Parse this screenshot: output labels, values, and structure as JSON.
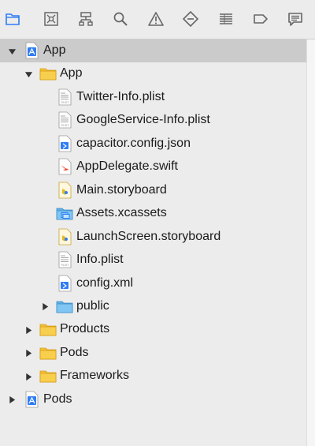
{
  "toolbar": {
    "items": [
      {
        "name": "project-navigator-icon",
        "active": true
      },
      {
        "name": "source-control-icon"
      },
      {
        "name": "symbol-navigator-icon"
      },
      {
        "name": "find-navigator-icon"
      },
      {
        "name": "issue-navigator-icon"
      },
      {
        "name": "test-navigator-icon"
      },
      {
        "name": "debug-navigator-icon"
      },
      {
        "name": "breakpoint-navigator-icon"
      },
      {
        "name": "report-navigator-icon"
      }
    ],
    "accent": "#2f7cf6"
  },
  "tree": {
    "rows": [
      {
        "label": "App",
        "icon": "xcode-project-icon",
        "level": 0,
        "disclosure": "expanded",
        "selected": true
      },
      {
        "label": "App",
        "icon": "folder-icon",
        "level": 1,
        "disclosure": "expanded"
      },
      {
        "label": "Twitter-Info.plist",
        "icon": "plist-file-icon",
        "level": 2,
        "disclosure": "none"
      },
      {
        "label": "GoogleService-Info.plist",
        "icon": "plist-file-icon",
        "level": 2,
        "disclosure": "none"
      },
      {
        "label": "capacitor.config.json",
        "icon": "json-file-icon",
        "level": 2,
        "disclosure": "none"
      },
      {
        "label": "AppDelegate.swift",
        "icon": "swift-file-icon",
        "level": 2,
        "disclosure": "none"
      },
      {
        "label": "Main.storyboard",
        "icon": "storyboard-file-icon",
        "level": 2,
        "disclosure": "none"
      },
      {
        "label": "Assets.xcassets",
        "icon": "asset-catalog-icon",
        "level": 2,
        "disclosure": "none"
      },
      {
        "label": "LaunchScreen.storyboard",
        "icon": "storyboard-file-icon",
        "level": 2,
        "disclosure": "none"
      },
      {
        "label": "Info.plist",
        "icon": "plist-file-icon",
        "level": 2,
        "disclosure": "none"
      },
      {
        "label": "config.xml",
        "icon": "xml-file-icon",
        "level": 2,
        "disclosure": "none"
      },
      {
        "label": "public",
        "icon": "blue-folder-icon",
        "level": 2,
        "disclosure": "collapsed"
      },
      {
        "label": "Products",
        "icon": "folder-icon",
        "level": 1,
        "disclosure": "collapsed"
      },
      {
        "label": "Pods",
        "icon": "folder-icon",
        "level": 1,
        "disclosure": "collapsed"
      },
      {
        "label": "Frameworks",
        "icon": "folder-icon",
        "level": 1,
        "disclosure": "collapsed"
      },
      {
        "label": "Pods",
        "icon": "xcode-project-icon",
        "level": 0,
        "disclosure": "collapsed"
      }
    ]
  },
  "colors": {
    "selection": "#cbcbcb",
    "folder": "#f3c23a",
    "blue_folder": "#74c0f0",
    "swift": "#f05138",
    "project": "#2f7cf6"
  }
}
